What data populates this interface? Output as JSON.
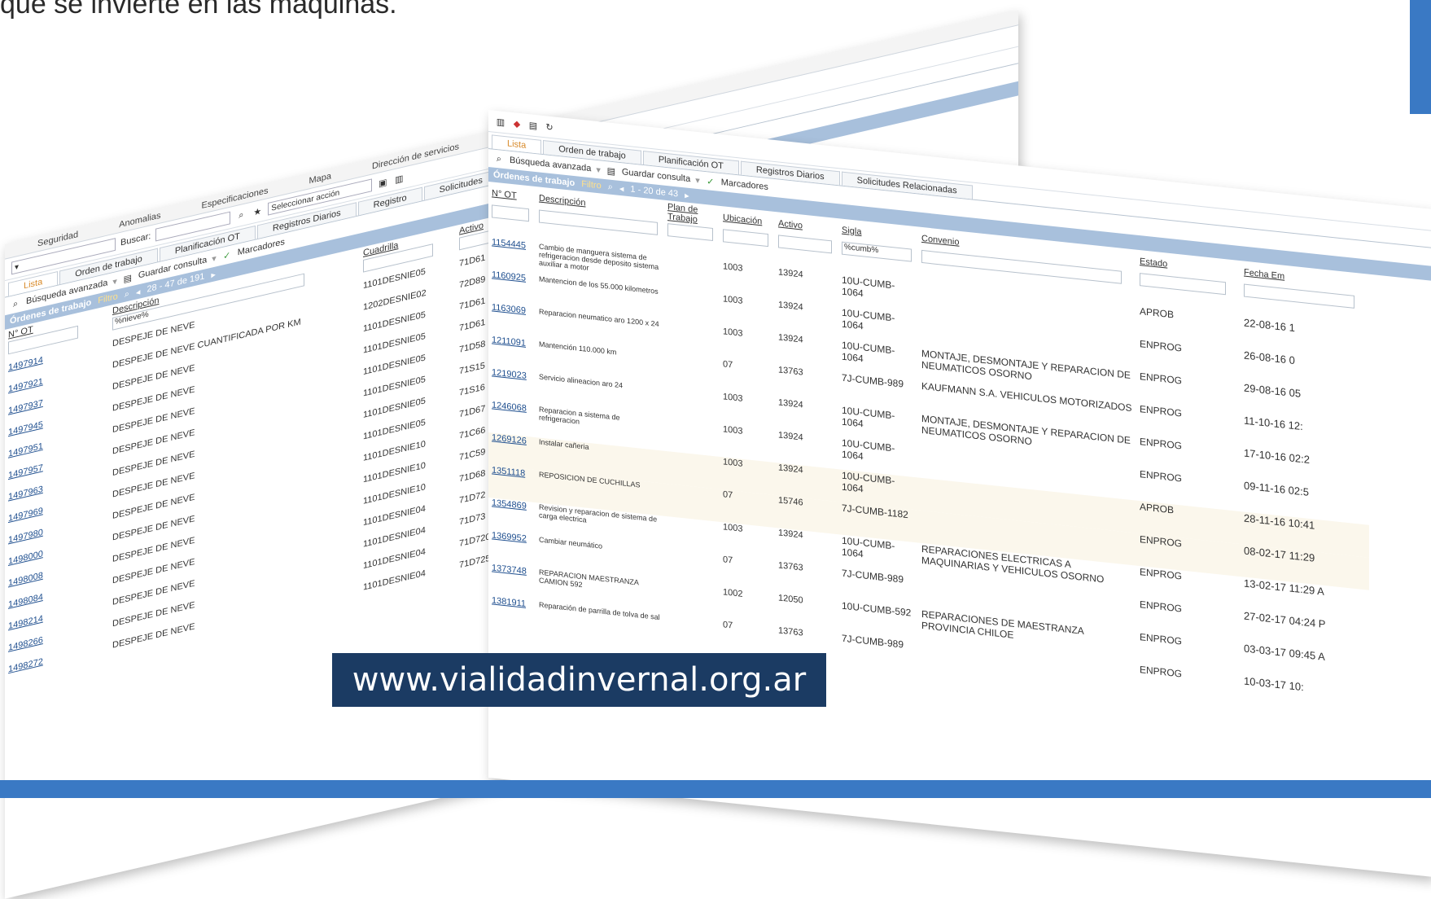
{
  "slide": {
    "header_text": "que se invierte en las maquinas.",
    "footer_url": "www.vialidadinvernal.org.ar"
  },
  "colors": {
    "accent_blue": "#3a79c4",
    "url_box": "#1b3b63",
    "panel_header": "#a8c0dc"
  },
  "back_window": {
    "menu": [
      "Seguridad",
      "Anomalias",
      "Especificaciones",
      "Mapa",
      "Dirección de servicios"
    ],
    "search_label": "Buscar:",
    "action_select": "Seleccionar acción",
    "tabs": [
      "Lista",
      "Orden de trabajo",
      "Planificación OT",
      "Registros Diarios",
      "Registro",
      "Solicitudes"
    ],
    "subbar": {
      "advanced": "Búsqueda avanzada",
      "save": "Guardar consulta",
      "bookmarks": "Marcadores"
    },
    "panel": {
      "title": "Órdenes de trabajo",
      "filter": "Filtro",
      "range": "28 - 47 de 191"
    },
    "columns": {
      "ot": "N° OT",
      "desc": "Descripción",
      "crew": "Cuadrilla",
      "asset": "Activo"
    },
    "desc_filter": "%nieve%",
    "rows": [
      {
        "ot": "1497914",
        "desc": "DESPEJE DE NEVE",
        "crew": "1101DESNIE05",
        "asset": "71D61"
      },
      {
        "ot": "1497921",
        "desc": "DESPEJE DE NEVE CUANTIFICADA POR KM",
        "crew": "1202DESNIE02",
        "asset": "72D89"
      },
      {
        "ot": "1497937",
        "desc": "DESPEJE DE NEVE",
        "crew": "1101DESNIE05",
        "asset": "71D61"
      },
      {
        "ot": "1497945",
        "desc": "DESPEJE DE NEVE",
        "crew": "1101DESNIE05",
        "asset": "71D61"
      },
      {
        "ot": "1497951",
        "desc": "DESPEJE DE NEVE",
        "crew": "1101DESNIE05",
        "asset": "71D58"
      },
      {
        "ot": "1497957",
        "desc": "DESPEJE DE NEVE",
        "crew": "1101DESNIE05",
        "asset": "71S15"
      },
      {
        "ot": "1497963",
        "desc": "DESPEJE DE NEVE",
        "crew": "1101DESNIE05",
        "asset": "71S16"
      },
      {
        "ot": "1497969",
        "desc": "DESPEJE DE NEVE",
        "crew": "1101DESNIE05",
        "asset": "71D67"
      },
      {
        "ot": "1497980",
        "desc": "DESPEJE DE NEVE",
        "crew": "1101DESNIE10",
        "asset": "71C66"
      },
      {
        "ot": "1498000",
        "desc": "DESPEJE DE NEVE",
        "crew": "1101DESNIE10",
        "asset": "71C59"
      },
      {
        "ot": "1498008",
        "desc": "DESPEJE DE NEVE",
        "crew": "1101DESNIE10",
        "asset": "71D68"
      },
      {
        "ot": "1498084",
        "desc": "DESPEJE DE NEVE",
        "crew": "1101DESNIE04",
        "asset": "71D72"
      },
      {
        "ot": "1498214",
        "desc": "DESPEJE DE NEVE",
        "crew": "1101DESNIE04",
        "asset": "71D73"
      },
      {
        "ot": "1498266",
        "desc": "DESPEJE DE NEVE",
        "crew": "1101DESNIE04",
        "asset": "71D720"
      },
      {
        "ot": "1498272",
        "desc": "DESPEJE DE NEVE",
        "crew": "1101DESNIE04",
        "asset": "71D725"
      }
    ]
  },
  "front_window": {
    "tabs": [
      "Lista",
      "Orden de trabajo",
      "Planificación OT",
      "Registros Diarios",
      "Solicitudes Relacionadas"
    ],
    "subbar": {
      "advanced": "Búsqueda avanzada",
      "save": "Guardar consulta",
      "bookmarks": "Marcadores"
    },
    "panel": {
      "title": "Órdenes de trabajo",
      "filter": "Filtro",
      "range": "1 - 20 de 43"
    },
    "columns": {
      "ot": "N° OT",
      "desc": "Descripción",
      "plan": "Plan de Trabajo",
      "loc": "Ubicación",
      "asset": "Activo",
      "sigla": "Sigla",
      "convenio": "Convenio",
      "estado": "Estado",
      "fecha": "Fecha Em"
    },
    "sigla_filter": "%cumb%",
    "rows": [
      {
        "ot": "1154445",
        "desc": "Cambio de manguera sistema de refrigeracion desde deposito sistema auxiliar a motor",
        "loc": "1003",
        "asset": "13924",
        "sigla": "10U-CUMB-1064",
        "convenio": "",
        "estado": "APROB",
        "fecha": "22-08-16 1"
      },
      {
        "ot": "1160925",
        "desc": "Mantencion de los 55.000 kilometros",
        "loc": "1003",
        "asset": "13924",
        "sigla": "10U-CUMB-1064",
        "convenio": "",
        "estado": "ENPROG",
        "fecha": "26-08-16 0"
      },
      {
        "ot": "1163069",
        "desc": "Reparacion neumatico aro 1200 x 24",
        "loc": "1003",
        "asset": "13924",
        "sigla": "10U-CUMB-1064",
        "convenio": "MONTAJE, DESMONTAJE Y REPARACION DE NEUMATICOS OSORNO",
        "estado": "ENPROG",
        "fecha": "29-08-16 05"
      },
      {
        "ot": "1211091",
        "desc": "Mantención 110.000 km",
        "loc": "07",
        "asset": "13763",
        "sigla": "7J-CUMB-989",
        "convenio": "KAUFMANN S.A. VEHICULOS MOTORIZADOS",
        "estado": "ENPROG",
        "fecha": "11-10-16 12:"
      },
      {
        "ot": "1219023",
        "desc": "Servicio alineacion aro 24",
        "loc": "1003",
        "asset": "13924",
        "sigla": "10U-CUMB-1064",
        "convenio": "MONTAJE, DESMONTAJE Y REPARACION DE NEUMATICOS OSORNO",
        "estado": "ENPROG",
        "fecha": "17-10-16 02:2"
      },
      {
        "ot": "1246068",
        "desc": "Reparacion a sistema de refrigeracion",
        "loc": "1003",
        "asset": "13924",
        "sigla": "10U-CUMB-1064",
        "convenio": "",
        "estado": "ENPROG",
        "fecha": "09-11-16 02:5"
      },
      {
        "ot": "1269126",
        "desc": "Instalar cañeria",
        "loc": "1003",
        "asset": "13924",
        "sigla": "10U-CUMB-1064",
        "convenio": "",
        "estado": "APROB",
        "fecha": "28-11-16 10:41"
      },
      {
        "ot": "1351118",
        "desc": "REPOSICION DE CUCHILLAS",
        "loc": "07",
        "asset": "15746",
        "sigla": "7J-CUMB-1182",
        "convenio": "",
        "estado": "ENPROG",
        "fecha": "08-02-17 11:29"
      },
      {
        "ot": "1354869",
        "desc": "Revision y reparacion de sistema de carga electrica",
        "loc": "1003",
        "asset": "13924",
        "sigla": "10U-CUMB-1064",
        "convenio": "REPARACIONES ELECTRICAS A MAQUINARIAS Y VEHICULOS OSORNO",
        "estado": "ENPROG",
        "fecha": "13-02-17 11:29 A"
      },
      {
        "ot": "1369952",
        "desc": "Cambiar neumático",
        "loc": "07",
        "asset": "13763",
        "sigla": "7J-CUMB-989",
        "convenio": "",
        "estado": "ENPROG",
        "fecha": "27-02-17 04:24 P"
      },
      {
        "ot": "1373748",
        "desc": "REPARACION MAESTRANZA CAMION 592",
        "loc": "1002",
        "asset": "12050",
        "sigla": "10U-CUMB-592",
        "convenio": "REPARACIONES DE MAESTRANZA PROVINCIA CHILOE",
        "estado": "ENPROG",
        "fecha": "03-03-17 09:45 A"
      },
      {
        "ot": "1381911",
        "desc": "Reparación de parrilla de tolva de sal",
        "loc": "07",
        "asset": "13763",
        "sigla": "7J-CUMB-989",
        "convenio": "",
        "estado": "ENPROG",
        "fecha": "10-03-17 10:"
      }
    ]
  }
}
